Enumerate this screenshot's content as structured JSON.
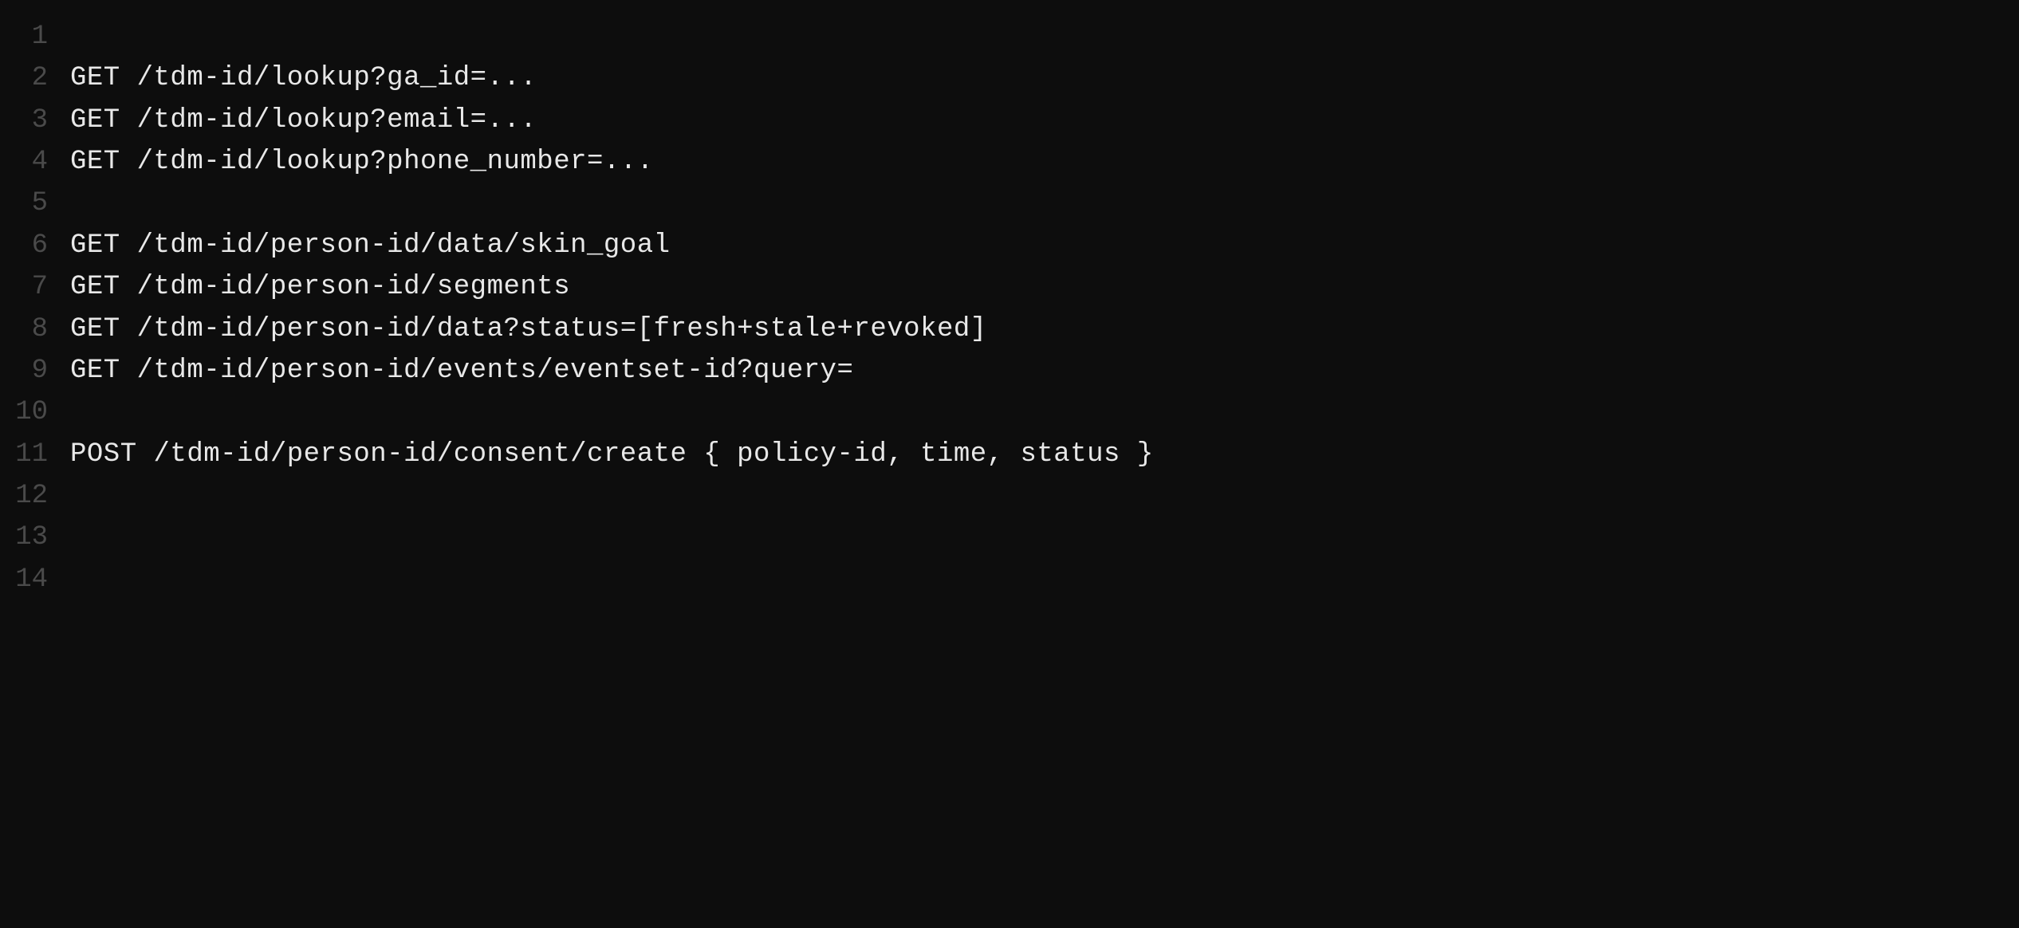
{
  "lines": [
    {
      "number": "1",
      "content": ""
    },
    {
      "number": "2",
      "content": "GET /tdm-id/lookup?ga_id=..."
    },
    {
      "number": "3",
      "content": "GET /tdm-id/lookup?email=..."
    },
    {
      "number": "4",
      "content": "GET /tdm-id/lookup?phone_number=..."
    },
    {
      "number": "5",
      "content": ""
    },
    {
      "number": "6",
      "content": "GET /tdm-id/person-id/data/skin_goal"
    },
    {
      "number": "7",
      "content": "GET /tdm-id/person-id/segments"
    },
    {
      "number": "8",
      "content": "GET /tdm-id/person-id/data?status=[fresh+stale+revoked]"
    },
    {
      "number": "9",
      "content": "GET /tdm-id/person-id/events/eventset-id?query="
    },
    {
      "number": "10",
      "content": ""
    },
    {
      "number": "11",
      "content": "POST /tdm-id/person-id/consent/create { policy-id, time, status }"
    },
    {
      "number": "12",
      "content": ""
    },
    {
      "number": "13",
      "content": ""
    },
    {
      "number": "14",
      "content": ""
    }
  ]
}
